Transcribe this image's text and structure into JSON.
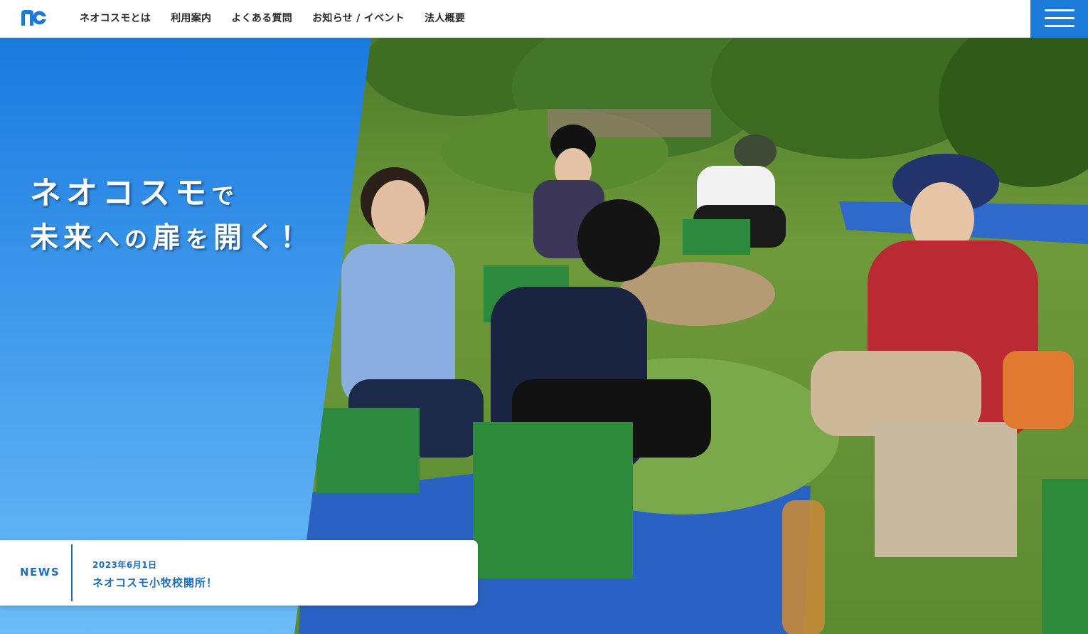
{
  "header": {
    "logo_text": "nc",
    "nav": [
      {
        "label": "ネオコスモとは"
      },
      {
        "label": "利用案内"
      },
      {
        "label": "よくある質問"
      },
      {
        "label": "お知らせ / イベント"
      },
      {
        "label": "法人概要"
      }
    ],
    "menu_icon": "hamburger-icon"
  },
  "hero": {
    "headline_line1_main": "ネオコスモ",
    "headline_line1_particle": "で",
    "headline_line2_a": "未来",
    "headline_line2_b": "への",
    "headline_line2_c": "扉",
    "headline_line2_d": "を",
    "headline_line2_e": "開く！",
    "photo_description_icon": "photo-image"
  },
  "news": {
    "label": "NEWS",
    "date": "2023年6月1日",
    "title": "ネオコスモ小牧校開所！"
  },
  "colors": {
    "brand_blue": "#1c7ad9",
    "news_blue": "#1b6ec2",
    "panel_top": "#1a7ae0",
    "panel_bottom": "#6bbcf7"
  }
}
